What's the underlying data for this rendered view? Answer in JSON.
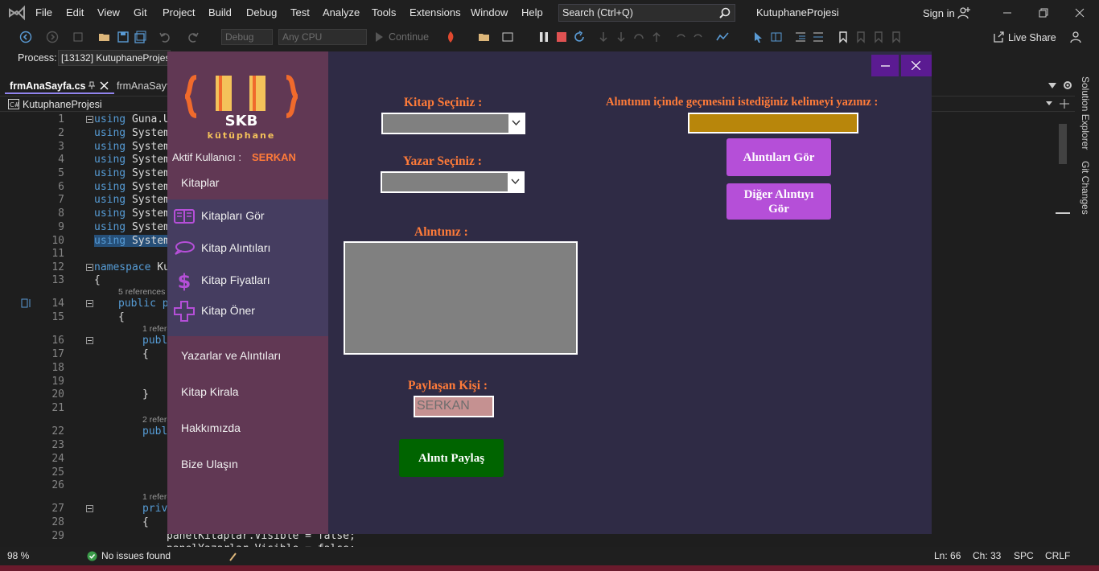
{
  "vs": {
    "menu": [
      "File",
      "Edit",
      "View",
      "Git",
      "Project",
      "Build",
      "Debug",
      "Test",
      "Analyze",
      "Tools",
      "Extensions",
      "Window",
      "Help"
    ],
    "search_placeholder": "Search (Ctrl+Q)",
    "project_title": "KutuphaneProjesi",
    "sign_in": "Sign in",
    "toolbar": {
      "config": "Debug",
      "platform": "Any CPU",
      "continue": "Continue",
      "live_share": "Live Share"
    },
    "process_label": "Process:",
    "process_value": "[13132] KutuphaneProjes",
    "tabs": [
      "frmAnaSayfa.cs",
      "frmAnaSayf"
    ],
    "nav_project": "KutuphaneProjesi",
    "dock_tabs": [
      "Solution Explorer",
      "Git Changes"
    ],
    "editor": {
      "line_numbers": [
        "1",
        "2",
        "3",
        "4",
        "5",
        "6",
        "7",
        "8",
        "9",
        "10",
        "11",
        "12",
        "13",
        "14",
        "15",
        "16",
        "17",
        "18",
        "19",
        "20",
        "21",
        "22",
        "23",
        "24",
        "25",
        "26",
        "27",
        "28",
        "29"
      ],
      "using_lines": [
        "Guna.UI",
        "System",
        "System",
        "System",
        "System",
        "System",
        "System",
        "System",
        "System",
        "System"
      ],
      "namespace_kw": "namespace",
      "namespace_name": "Ku",
      "brace_open": "{",
      "brace_close": "}",
      "refs_5": "5 references",
      "refs_1a": "1 referen",
      "refs_2": "2 referen",
      "refs_1b": "1 referen",
      "public_pa": "public pa",
      "publi": "publi",
      "priva": "priva",
      "line29": "panelKitaplar.Visible = false;",
      "line30": "panelYazarlar.Visible = false;"
    },
    "status": {
      "zoom": "98 %",
      "issues": "No issues found",
      "ln": "Ln: 66",
      "ch": "Ch: 33",
      "spc": "SPC",
      "crlf": "CRLF"
    }
  },
  "app": {
    "logo_text": "SKB",
    "logo_sub": "kütüphane",
    "user_label": "Aktif Kullanıcı :",
    "user_name": "SERKAN",
    "menu_main": "Kitaplar",
    "submenu": [
      {
        "label": "Kitapları Gör",
        "icon": "book-icon"
      },
      {
        "label": "Kitap Alıntıları",
        "icon": "speech-bubble-icon"
      },
      {
        "label": "Kitap Fiyatları",
        "icon": "dollar-icon"
      },
      {
        "label": "Kitap Öner",
        "icon": "plus-icon"
      }
    ],
    "menu_lower": [
      "Yazarlar ve Alıntıları",
      "Kitap Kirala",
      "Hakkımızda",
      "Bize Ulaşın"
    ],
    "book_label": "Kitap Seçiniz :",
    "author_label": "Yazar Seçiniz :",
    "quote_label": "Alıntınız :",
    "sharer_label": "Paylaşan Kişi :",
    "sharer_value": "SERKAN",
    "share_button": "Alıntı Paylaş",
    "search_label": "Alıntının içinde geçmesini istediğiniz kelimeyi yazınız :",
    "see_quotes_button": "Alıntıları Gör",
    "other_quote_button": "Diğer Alıntıyı Gör",
    "colors": {
      "accent": "#ff7b39",
      "sidebar": "#613854",
      "submenu": "#453d60",
      "form_bg": "#2f2b45",
      "button_purple": "#b54fd8",
      "button_green": "#006400",
      "word_box": "#b8860b"
    }
  }
}
